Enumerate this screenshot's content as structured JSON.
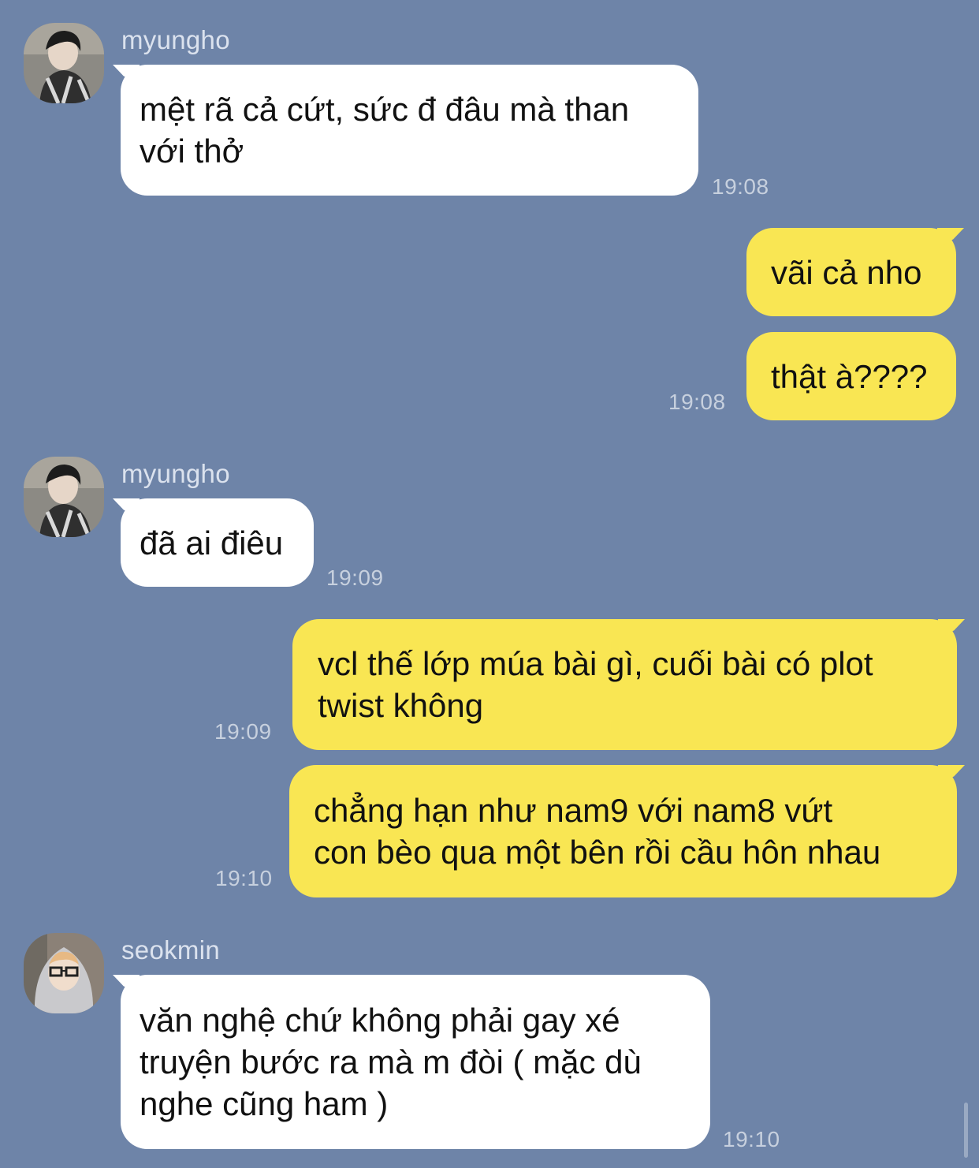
{
  "messages": [
    {
      "sender": "myungho",
      "lines": [
        "mệt rã cả cứt, sức đ đâu mà than",
        "với thở"
      ],
      "time": "19:08"
    },
    {
      "lines": [
        "vãi cả nho"
      ]
    },
    {
      "lines": [
        "thật à????"
      ],
      "time": "19:08"
    },
    {
      "sender": "myungho",
      "lines": [
        "đã ai điêu"
      ],
      "time": "19:09"
    },
    {
      "lines": [
        "vcl thế lớp múa bài gì, cuối bài có plot",
        "twist không"
      ],
      "time": "19:09"
    },
    {
      "lines": [
        "chẳng hạn như nam9 với nam8 vứt",
        "con bèo qua một bên rồi cầu hôn nhau"
      ],
      "time": "19:10"
    },
    {
      "sender": "seokmin",
      "lines": [
        "văn nghệ chứ không phải gay xé",
        "truyện bước ra mà m đòi ( mặc dù",
        "nghe cũng ham )"
      ],
      "time": "19:10"
    }
  ],
  "colors": {
    "background": "#6e84a8",
    "incoming_bubble": "#ffffff",
    "outgoing_bubble": "#f9e653"
  }
}
